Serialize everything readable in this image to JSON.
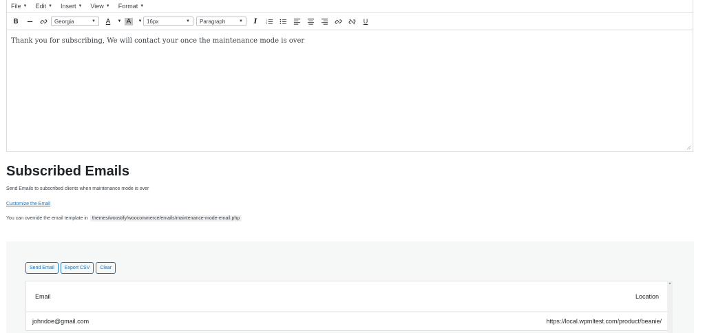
{
  "menubar": {
    "items": [
      "File",
      "Edit",
      "Insert",
      "View",
      "Format"
    ]
  },
  "toolbar": {
    "font_family": "Georgia",
    "font_size": "16px",
    "block_format": "Paragraph",
    "bold": "B",
    "italic": "I",
    "underline": "U"
  },
  "editor": {
    "content": "Thank you for subscribing, We will contact your once the maintenance mode is over"
  },
  "section": {
    "title": "Subscribed Emails",
    "description": "Send Emails to subscribed clients when maintenance mode is over",
    "customize_link": "Customize the Email",
    "override_text": "You can override the email template in",
    "template_path": "themes/woostify/woocommerce/emails/maintenance-mode-email.php"
  },
  "actions": {
    "send": "Send Email",
    "export": "Export CSV",
    "clear": "Clear"
  },
  "table": {
    "headers": {
      "email": "Email",
      "location": "Location"
    },
    "rows": [
      {
        "email": "johndoe@gmail.com",
        "location": "https://local.wpmltest.com/product/beanie/"
      }
    ]
  },
  "colors": {
    "accent": "#2271b1",
    "panel": "#f6f7f7",
    "text": "#1d2327"
  }
}
